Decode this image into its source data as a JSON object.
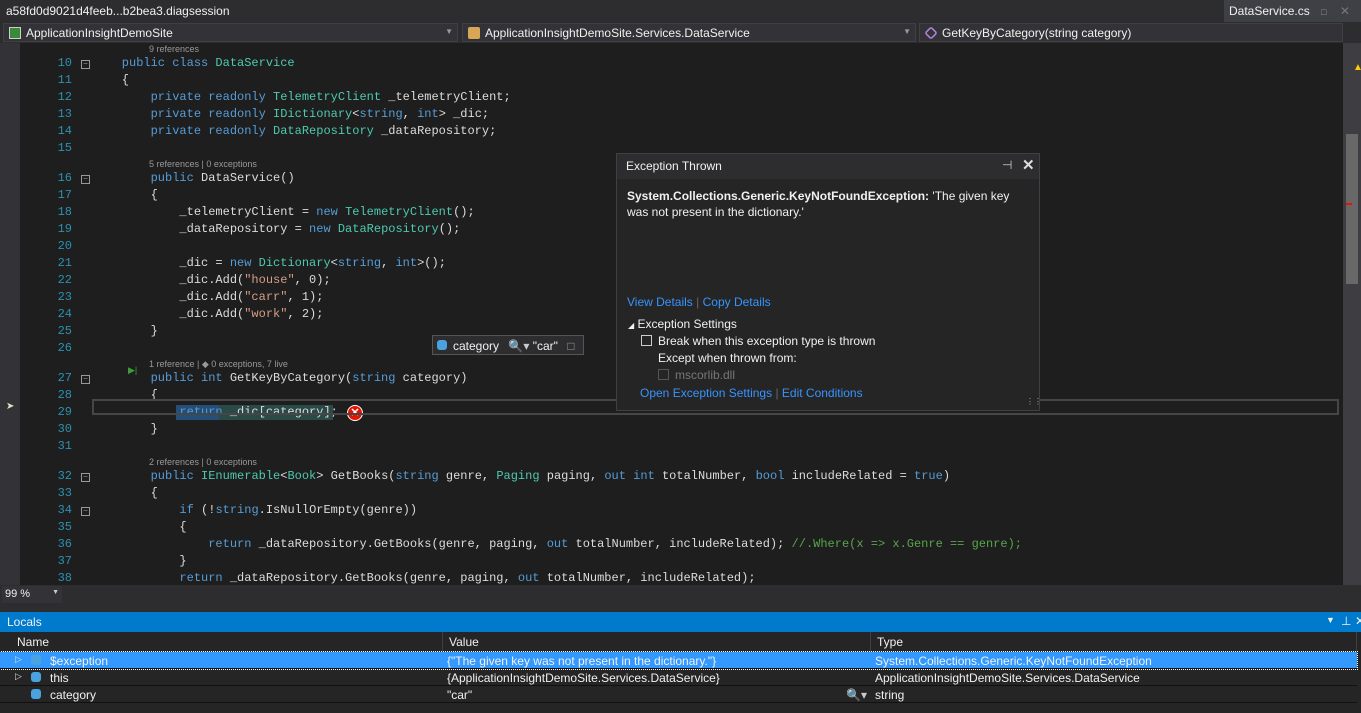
{
  "titlebar": {
    "session": "a58fd0d9021d4feeb...b2bea3.diagsession",
    "tab": "DataService.cs"
  },
  "nav": {
    "project": "ApplicationInsightDemoSite",
    "class": "ApplicationInsightDemoSite.Services.DataService",
    "member": "GetKeyByCategory(string category)"
  },
  "colors": {
    "keyword": "#569cd6",
    "type": "#4ec9b0",
    "string": "#d69d85",
    "comment": "#57a64a",
    "accent": "#007acc",
    "error": "#e51400"
  },
  "code": [
    {
      "lens": "9 references"
    },
    {
      "n": 10,
      "fold": true,
      "t": [
        [
          "    public class ",
          "kw"
        ],
        [
          "DataService",
          "ty"
        ]
      ]
    },
    {
      "n": 11,
      "t": [
        [
          "    {",
          "tx"
        ]
      ]
    },
    {
      "n": 12,
      "t": [
        [
          "        private readonly ",
          "kw"
        ],
        [
          "TelemetryClient",
          "ty"
        ],
        [
          " _telemetryClient;",
          "tx"
        ]
      ]
    },
    {
      "n": 13,
      "t": [
        [
          "        private readonly ",
          "kw"
        ],
        [
          "IDictionary",
          "ty"
        ],
        [
          "<",
          "tx"
        ],
        [
          "string",
          "kw"
        ],
        [
          ", ",
          "tx"
        ],
        [
          "int",
          "kw"
        ],
        [
          "> _dic;",
          "tx"
        ]
      ]
    },
    {
      "n": 14,
      "t": [
        [
          "        private readonly ",
          "kw"
        ],
        [
          "DataRepository",
          "ty"
        ],
        [
          " _dataRepository;",
          "tx"
        ]
      ]
    },
    {
      "n": 15,
      "t": []
    },
    {
      "lens": "5 references | 0 exceptions"
    },
    {
      "n": 16,
      "fold": true,
      "t": [
        [
          "        public ",
          "kw"
        ],
        [
          "DataService()",
          "tx"
        ]
      ]
    },
    {
      "n": 17,
      "t": [
        [
          "        {",
          "tx"
        ]
      ]
    },
    {
      "n": 18,
      "t": [
        [
          "            _telemetryClient = ",
          "tx"
        ],
        [
          "new ",
          "kw"
        ],
        [
          "TelemetryClient",
          "ty"
        ],
        [
          "();",
          "tx"
        ]
      ]
    },
    {
      "n": 19,
      "t": [
        [
          "            _dataRepository = ",
          "tx"
        ],
        [
          "new ",
          "kw"
        ],
        [
          "DataRepository",
          "ty"
        ],
        [
          "();",
          "tx"
        ]
      ]
    },
    {
      "n": 20,
      "t": []
    },
    {
      "n": 21,
      "t": [
        [
          "            _dic = ",
          "tx"
        ],
        [
          "new ",
          "kw"
        ],
        [
          "Dictionary",
          "ty"
        ],
        [
          "<",
          "tx"
        ],
        [
          "string",
          "kw"
        ],
        [
          ", ",
          "tx"
        ],
        [
          "int",
          "kw"
        ],
        [
          ">();",
          "tx"
        ]
      ]
    },
    {
      "n": 22,
      "t": [
        [
          "            _dic.Add(",
          "tx"
        ],
        [
          "\"house\"",
          "st"
        ],
        [
          ", 0);",
          "tx"
        ]
      ]
    },
    {
      "n": 23,
      "t": [
        [
          "            _dic.Add(",
          "tx"
        ],
        [
          "\"carr\"",
          "st"
        ],
        [
          ", 1);",
          "tx"
        ]
      ]
    },
    {
      "n": 24,
      "t": [
        [
          "            _dic.Add(",
          "tx"
        ],
        [
          "\"work\"",
          "st"
        ],
        [
          ", 2);",
          "tx"
        ]
      ]
    },
    {
      "n": 25,
      "t": [
        [
          "        }",
          "tx"
        ]
      ]
    },
    {
      "n": 26,
      "t": []
    },
    {
      "lens": "1 reference | ◆ 0 exceptions, 7 live"
    },
    {
      "n": 27,
      "fold": true,
      "t": [
        [
          "        public int ",
          "kw"
        ],
        [
          "GetKeyByCategory(",
          "tx"
        ],
        [
          "string ",
          "kw"
        ],
        [
          "category)",
          "tx"
        ]
      ]
    },
    {
      "n": 28,
      "t": [
        [
          "        {",
          "tx"
        ]
      ]
    },
    {
      "n": 29,
      "t": [
        [
          "            return",
          "kw"
        ],
        [
          " _dic[category];",
          "tx"
        ]
      ]
    },
    {
      "n": 30,
      "t": [
        [
          "        }",
          "tx"
        ]
      ]
    },
    {
      "n": 31,
      "t": []
    },
    {
      "lens": "2 references | 0 exceptions"
    },
    {
      "n": 32,
      "fold": true,
      "t": [
        [
          "        public ",
          "kw"
        ],
        [
          "IEnumerable",
          "ty"
        ],
        [
          "<",
          "tx"
        ],
        [
          "Book",
          "ty"
        ],
        [
          "> GetBooks(",
          "tx"
        ],
        [
          "string ",
          "kw"
        ],
        [
          "genre, ",
          "tx"
        ],
        [
          "Paging ",
          "ty"
        ],
        [
          "paging, ",
          "tx"
        ],
        [
          "out int ",
          "kw"
        ],
        [
          "totalNumber, ",
          "tx"
        ],
        [
          "bool ",
          "kw"
        ],
        [
          "includeRelated = ",
          "tx"
        ],
        [
          "true",
          "kw"
        ],
        [
          ")",
          "tx"
        ]
      ]
    },
    {
      "n": 33,
      "t": [
        [
          "        {",
          "tx"
        ]
      ]
    },
    {
      "n": 34,
      "fold": true,
      "t": [
        [
          "            if ",
          "kw"
        ],
        [
          "(!",
          "tx"
        ],
        [
          "string",
          "kw"
        ],
        [
          ".IsNullOrEmpty(genre))",
          "tx"
        ]
      ]
    },
    {
      "n": 35,
      "t": [
        [
          "            {",
          "tx"
        ]
      ]
    },
    {
      "n": 36,
      "t": [
        [
          "                return ",
          "kw"
        ],
        [
          "_dataRepository.GetBooks(genre, paging, ",
          "tx"
        ],
        [
          "out ",
          "kw"
        ],
        [
          "totalNumber, includeRelated); ",
          "tx"
        ],
        [
          "//.Where(x => x.Genre == genre);",
          "cm"
        ]
      ]
    },
    {
      "n": 37,
      "t": [
        [
          "            }",
          "tx"
        ]
      ]
    },
    {
      "n": 38,
      "t": [
        [
          "            return ",
          "kw"
        ],
        [
          "_dataRepository.GetBooks(genre, paging, ",
          "tx"
        ],
        [
          "out ",
          "kw"
        ],
        [
          "totalNumber, includeRelated);",
          "tx"
        ]
      ]
    },
    {
      "n": 39,
      "t": [
        [
          "        }",
          "tx"
        ]
      ]
    }
  ],
  "datatip": {
    "name": "category",
    "value": "\"car\""
  },
  "exception": {
    "title": "Exception Thrown",
    "type": "System.Collections.Generic.KeyNotFoundException:",
    "message": "'The given key was not present in the dictionary.'",
    "view_details": "View Details",
    "copy_details": "Copy Details",
    "settings_header": "Exception Settings",
    "break_label": "Break when this exception type is thrown",
    "break_checked": false,
    "except_label": "Except when thrown from:",
    "module": "mscorlib.dll",
    "open_settings": "Open Exception Settings",
    "edit_conditions": "Edit Conditions"
  },
  "zoom": "99 %",
  "locals": {
    "title": "Locals",
    "columns": [
      "Name",
      "Value",
      "Type"
    ],
    "rows": [
      {
        "name": "$exception",
        "value": "{\"The given key was not present in the dictionary.\"}",
        "type": "System.Collections.Generic.KeyNotFoundException",
        "expandable": true,
        "selected": true
      },
      {
        "name": "this",
        "value": "{ApplicationInsightDemoSite.Services.DataService}",
        "type": "ApplicationInsightDemoSite.Services.DataService",
        "expandable": true,
        "selected": false
      },
      {
        "name": "category",
        "value": "\"car\"",
        "type": "string",
        "expandable": false,
        "selected": false
      }
    ]
  }
}
